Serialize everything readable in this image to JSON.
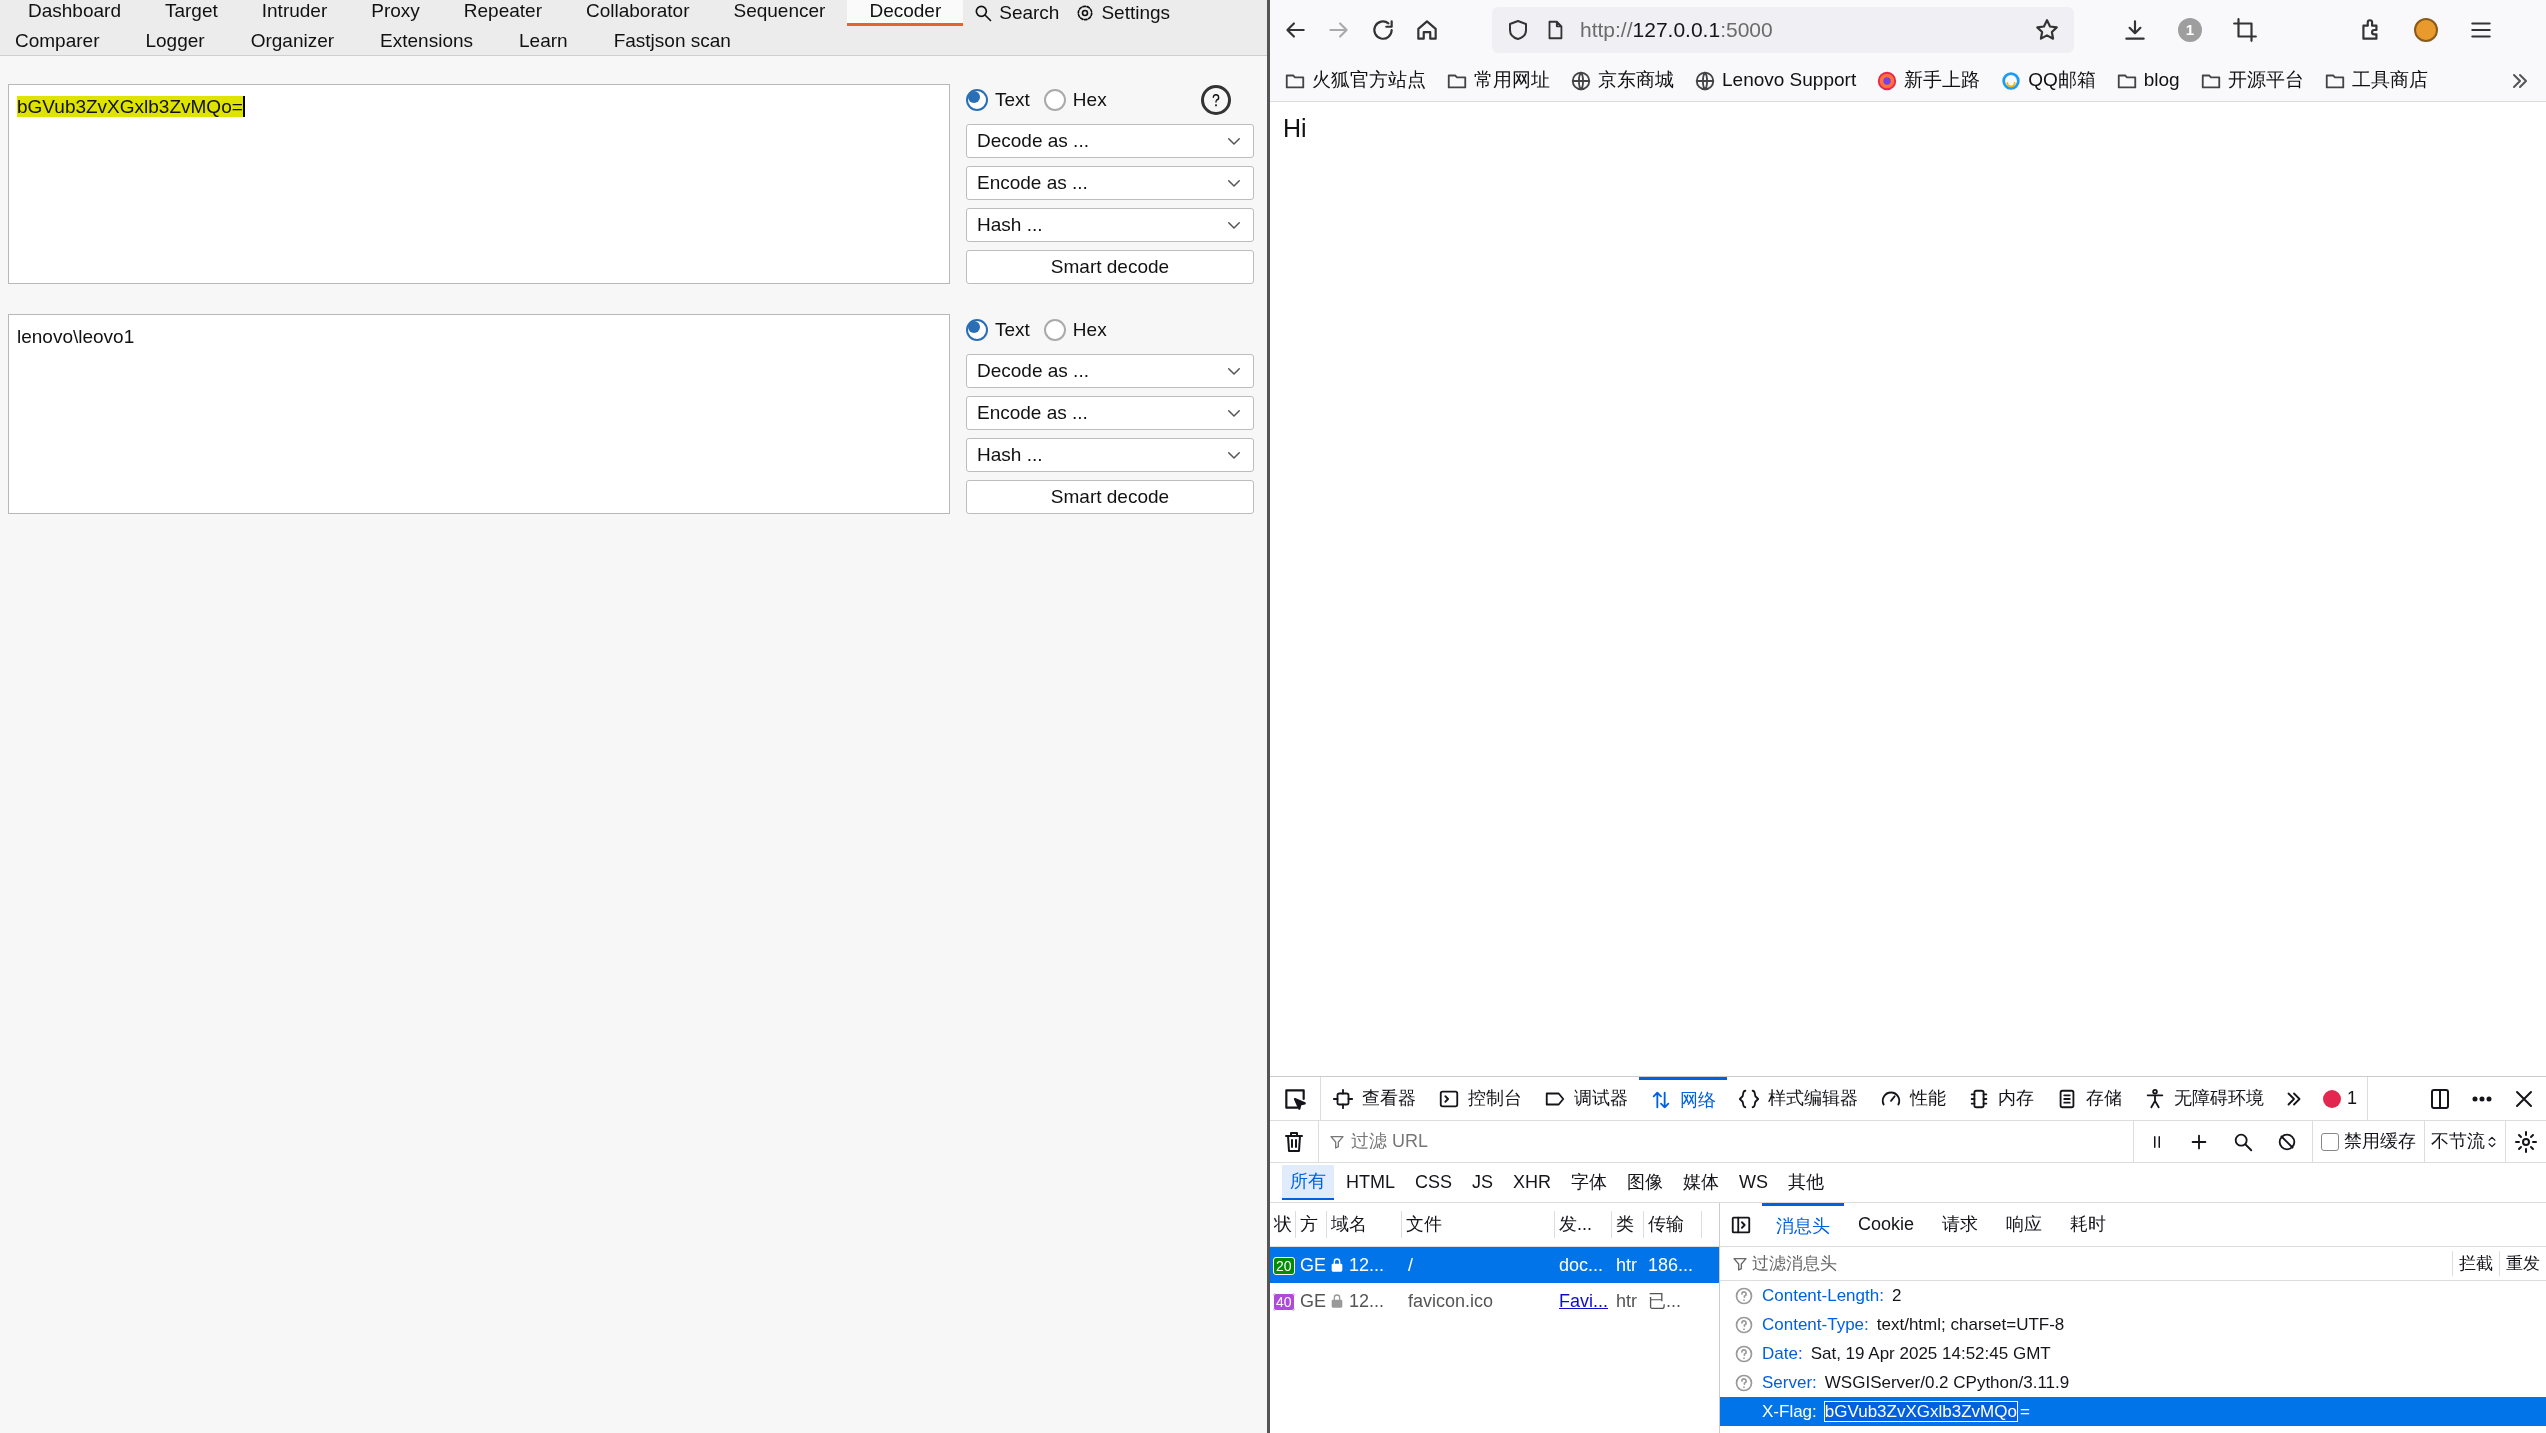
{
  "burp": {
    "tabs_top": [
      {
        "label": "Dashboard",
        "selected": false
      },
      {
        "label": "Target",
        "selected": false
      },
      {
        "label": "Intruder",
        "selected": false
      },
      {
        "label": "Proxy",
        "selected": false
      },
      {
        "label": "Repeater",
        "selected": false
      },
      {
        "label": "Collaborator",
        "selected": false
      },
      {
        "label": "Sequencer",
        "selected": false
      },
      {
        "label": "Decoder",
        "selected": true
      }
    ],
    "search": "Search",
    "settings": "Settings",
    "tabs_bottom": [
      {
        "label": "Comparer",
        "selected": false
      },
      {
        "label": "Logger",
        "selected": false
      },
      {
        "label": "Organizer",
        "selected": false
      },
      {
        "label": "Extensions",
        "selected": false
      },
      {
        "label": "Learn",
        "selected": false
      },
      {
        "label": "Fastjson scan",
        "selected": false
      }
    ],
    "panels": [
      {
        "text": "bGVub3ZvXGxlb3ZvMQo=",
        "highlighted": true,
        "formats": [
          {
            "label": "Text",
            "selected": true
          },
          {
            "label": "Hex",
            "selected": false
          }
        ],
        "help": true,
        "dropdowns": [
          "Decode as ...",
          "Encode as ...",
          "Hash ..."
        ],
        "button": "Smart decode"
      },
      {
        "text": "lenovo\\leovo1",
        "highlighted": false,
        "formats": [
          {
            "label": "Text",
            "selected": true
          },
          {
            "label": "Hex",
            "selected": false
          }
        ],
        "help": false,
        "dropdowns": [
          "Decode as ...",
          "Encode as ...",
          "Hash ..."
        ],
        "button": "Smart decode"
      }
    ]
  },
  "browser": {
    "url_scheme": "http://",
    "url_host": "127.0.0.1",
    "url_port": ":5000",
    "badge": "1",
    "bookmarks": [
      {
        "label": "火狐官方站点",
        "kind": "folder"
      },
      {
        "label": "常用网址",
        "kind": "folder"
      },
      {
        "label": "京东商城",
        "kind": "globe"
      },
      {
        "label": "Lenovo Support",
        "kind": "globe"
      },
      {
        "label": "新手上路",
        "kind": "firefox"
      },
      {
        "label": "QQ邮箱",
        "kind": "qq"
      },
      {
        "label": "blog",
        "kind": "folder"
      },
      {
        "label": "开源平台",
        "kind": "folder"
      },
      {
        "label": "工具商店",
        "kind": "folder"
      }
    ],
    "page_text": "Hi"
  },
  "devtools": {
    "tabs": [
      {
        "label": "查看器",
        "kind": "inspector",
        "selected": false
      },
      {
        "label": "控制台",
        "kind": "console",
        "selected": false
      },
      {
        "label": "调试器",
        "kind": "debugger",
        "selected": false
      },
      {
        "label": "网络",
        "kind": "network",
        "selected": true
      },
      {
        "label": "样式编辑器",
        "kind": "style",
        "selected": false
      },
      {
        "label": "性能",
        "kind": "performance",
        "selected": false
      },
      {
        "label": "内存",
        "kind": "memory",
        "selected": false
      },
      {
        "label": "存储",
        "kind": "storage",
        "selected": false
      },
      {
        "label": "无障碍环境",
        "kind": "accessibility",
        "selected": false
      }
    ],
    "error_count": "1",
    "filter_placeholder": "过滤 URL",
    "disable_cache": {
      "label": "禁用缓存",
      "checked": false
    },
    "throttle": "不节流",
    "type_filters": [
      {
        "label": "所有",
        "selected": true
      },
      {
        "label": "HTML",
        "selected": false
      },
      {
        "label": "CSS",
        "selected": false
      },
      {
        "label": "JS",
        "selected": false
      },
      {
        "label": "XHR",
        "selected": false
      },
      {
        "label": "字体",
        "selected": false
      },
      {
        "label": "图像",
        "selected": false
      },
      {
        "label": "媒体",
        "selected": false
      },
      {
        "label": "WS",
        "selected": false
      },
      {
        "label": "其他",
        "selected": false
      }
    ],
    "columns": [
      "状",
      "方",
      "域名",
      "文件",
      "发...",
      "类",
      "传输"
    ],
    "requests": [
      {
        "status": "20",
        "color": "#058b00",
        "method": "GE",
        "domain": "12...",
        "file": "/",
        "initiator": "doc...",
        "initiator_link": false,
        "type": "htr",
        "transfer": "186...",
        "selected": true
      },
      {
        "status": "40",
        "color": "#b04ad8",
        "method": "GE",
        "domain": "12...",
        "file": "favicon.ico",
        "initiator": "Favi...",
        "initiator_link": true,
        "type": "htr",
        "transfer": "已...",
        "selected": false
      }
    ],
    "detail_tabs": [
      {
        "label": "消息头",
        "selected": true
      },
      {
        "label": "Cookie",
        "selected": false
      },
      {
        "label": "请求",
        "selected": false
      },
      {
        "label": "响应",
        "selected": false
      },
      {
        "label": "耗时",
        "selected": false
      }
    ],
    "header_filter_placeholder": "过滤消息头",
    "actions": [
      "拦截",
      "重发"
    ],
    "headers": [
      {
        "name": "Content-Length:",
        "value_parts": [
          {
            "text": "2",
            "selected": false
          }
        ],
        "selected": false
      },
      {
        "name": "Content-Type:",
        "value_parts": [
          {
            "text": "text/html; charset=UTF-8",
            "selected": false
          }
        ],
        "selected": false
      },
      {
        "name": "Date:",
        "value_parts": [
          {
            "text": "Sat, 19 Apr 2025 14:52:45 GMT",
            "selected": false
          }
        ],
        "selected": false
      },
      {
        "name": "Server:",
        "value_parts": [
          {
            "text": "WSGIServer/0.2 CPython/3.11.9",
            "selected": false
          }
        ],
        "selected": false
      },
      {
        "name": "X-Flag:",
        "value_parts": [
          {
            "text": "bGVub3ZvXGxlb3ZvMQo",
            "selected": true
          },
          {
            "text": "=",
            "selected": false
          }
        ],
        "selected": true
      }
    ]
  }
}
